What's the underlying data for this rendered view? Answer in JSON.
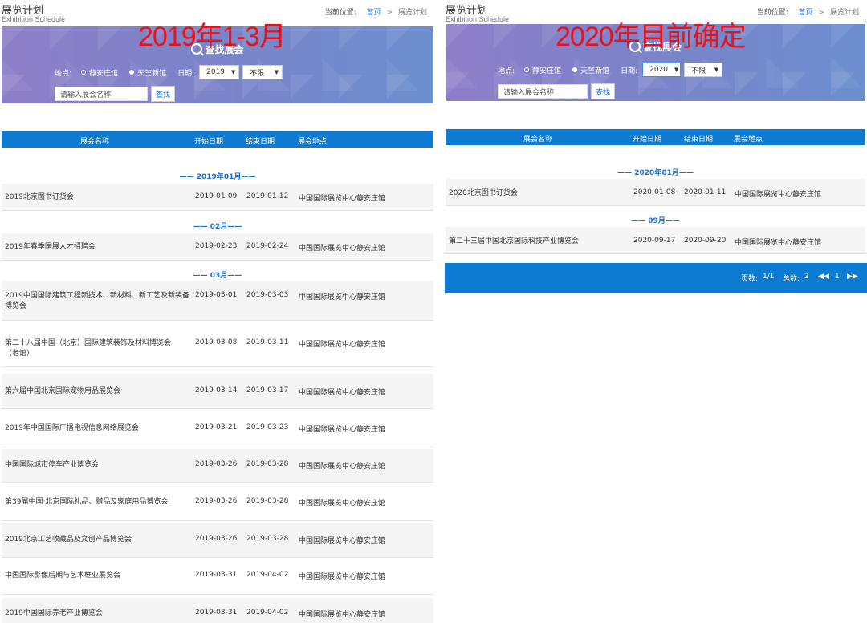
{
  "panels": {
    "left": {
      "overlay": "2019年1-3月",
      "header": {
        "title": "展览计划",
        "subtitle": "Exhibition Schedule",
        "crumb_label": "当前位置:",
        "crumb_home": "首页",
        "crumb_sep": ">",
        "crumb_current": "展览计划"
      },
      "search": {
        "title": "查找展会",
        "location_label": "地点:",
        "venue_1": "静安庄馆",
        "venue_2": "天竺新馆",
        "date_label": "日期:",
        "year": "2019",
        "month": "不限",
        "name_placeholder": "请输入展会名称",
        "button": "查找"
      },
      "columns": {
        "name": "展会名称",
        "start": "开始日期",
        "end": "结束日期",
        "venue": "展会地点"
      },
      "groups": [
        {
          "month": "—— 2019年01月——"
        },
        {
          "month": "—— 02月——"
        },
        {
          "month": "—— 03月——"
        }
      ],
      "rows": [
        {
          "name": "2019北京图书订货会",
          "start": "2019-01-09",
          "end": "2019-01-12",
          "venue": "中国国际展览中心静安庄馆"
        },
        {
          "name": "2019年春季国展人才招聘会",
          "start": "2019-02-23",
          "end": "2019-02-24",
          "venue": "中国国际展览中心静安庄馆"
        },
        {
          "name": "2019中国国际建筑工程新技术、新材料、新工艺及新装备博览会",
          "start": "2019-03-01",
          "end": "2019-03-03",
          "venue": "中国国际展览中心静安庄馆"
        },
        {
          "name": "第二十八届中国（北京）国际建筑装饰及材料博览会（老馆）",
          "start": "2019-03-08",
          "end": "2019-03-11",
          "venue": "中国国际展览中心静安庄馆"
        },
        {
          "name": "第六届中国北京国际宠物用品展览会",
          "start": "2019-03-14",
          "end": "2019-03-17",
          "venue": "中国国际展览中心静安庄馆"
        },
        {
          "name": "2019年中国国际广播电视信息网络展览会",
          "start": "2019-03-21",
          "end": "2019-03-23",
          "venue": "中国国际展览中心静安庄馆"
        },
        {
          "name": "中国国际城市停车产业博览会",
          "start": "2019-03-26",
          "end": "2019-03-28",
          "venue": "中国国际展览中心静安庄馆"
        },
        {
          "name": "第39届中国·北京国际礼品、赠品及家庭用品博览会",
          "start": "2019-03-26",
          "end": "2019-03-28",
          "venue": "中国国际展览中心静安庄馆"
        },
        {
          "name": "2019北京工艺收藏品及文创产品博览会",
          "start": "2019-03-26",
          "end": "2019-03-28",
          "venue": "中国国际展览中心静安庄馆"
        },
        {
          "name": "中国国际影像后期与艺术框业展览会",
          "start": "2019-03-31",
          "end": "2019-04-02",
          "venue": "中国国际展览中心静安庄馆"
        },
        {
          "name": "2019中国国际养老产业博览会",
          "start": "2019-03-31",
          "end": "2019-04-02",
          "venue": "中国国际展览中心静安庄馆"
        }
      ]
    },
    "right": {
      "overlay": "2020年目前确定",
      "header": {
        "title": "展览计划",
        "subtitle": "Exhibition Schedule",
        "crumb_label": "当前位置:",
        "crumb_home": "首页",
        "crumb_sep": ">",
        "crumb_current": "展览计划"
      },
      "search": {
        "title": "查找展会",
        "location_label": "地点:",
        "venue_1": "静安庄馆",
        "venue_2": "天竺新馆",
        "date_label": "日期:",
        "year": "2020",
        "month": "不限",
        "name_placeholder": "请输入展会名称",
        "button": "查找"
      },
      "columns": {
        "name": "展会名称",
        "start": "开始日期",
        "end": "结束日期",
        "venue": "展会地点"
      },
      "groups": [
        {
          "month": "—— 2020年01月——"
        },
        {
          "month": "—— 09月——"
        }
      ],
      "rows": [
        {
          "name": "2020北京图书订货会",
          "start": "2020-01-08",
          "end": "2020-01-11",
          "venue": "中国国际展览中心静安庄馆"
        },
        {
          "name": "第二十三届中国北京国际科技产业博览会",
          "start": "2020-09-17",
          "end": "2020-09-20",
          "venue": "中国国际展览中心静安庄馆"
        }
      ],
      "pager": {
        "pages_label": "页数:",
        "pages_value": "1/1",
        "total_label": "总数:",
        "total_value": "2",
        "prev": "◀◀",
        "current": "1",
        "next": "▶▶"
      }
    }
  }
}
